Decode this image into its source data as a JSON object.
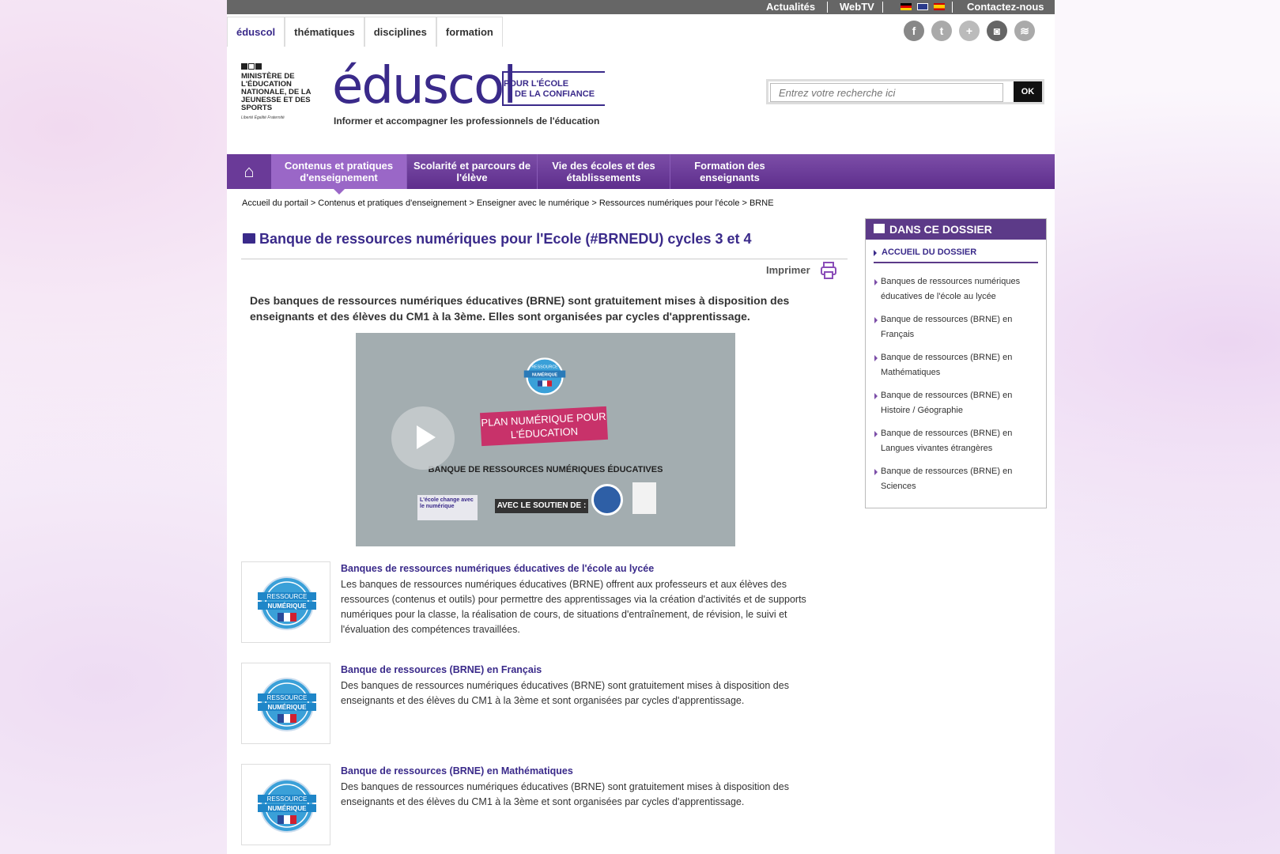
{
  "topbar": {
    "actualites": "Actualités",
    "webtv": "WebTV",
    "contact": "Contactez-nous"
  },
  "tabs": [
    "éduscol",
    "thématiques",
    "disciplines",
    "formation"
  ],
  "social": [
    "f",
    "t",
    "+",
    "◙",
    "≋"
  ],
  "ministry": {
    "text": "MINISTÈRE DE L'ÉDUCATION NATIONALE, DE LA JEUNESSE ET DES SPORTS",
    "motto": "Liberté Égalité Fraternité"
  },
  "logo": {
    "name": "éduscol",
    "tag1": "POUR L'ÉCOLE",
    "tag2": "DE LA CONFIANCE",
    "subtitle": "Informer et accompagner les professionnels de l'éducation"
  },
  "search": {
    "placeholder": "Entrez votre recherche ici",
    "button": "OK"
  },
  "menu": {
    "home_icon": "⌂",
    "items": [
      "Contenus et pratiques d'enseignement",
      "Scolarité et parcours de l'élève",
      "Vie des écoles et des établissements",
      "Formation des enseignants"
    ]
  },
  "breadcrumb": "Accueil du portail > Contenus et pratiques d'enseignement > Enseigner avec le numérique > Ressources numériques pour l'école > BRNE",
  "title": "Banque de ressources numériques pour l'Ecole (#BRNEDU)  cycles 3 et 4",
  "print": "Imprimer",
  "intro": "Des banques de ressources numériques éducatives (BRNE) sont gratuitement mises à disposition des enseignants et des élèves du CM1 à la 3ème. Elles sont organisées par cycles d'apprentissage.",
  "video": {
    "badge1": "RESSOURCE",
    "badge2": "NUMÉRIQUE",
    "plan": "PLAN NUMÉRIQUE POUR L'ÉDUCATION",
    "banque": "BANQUE DE RESSOURCES NUMÉRIQUES ÉDUCATIVES",
    "ecole": "L'école change avec le numérique",
    "soutien": "AVEC LE SOUTIEN DE :"
  },
  "badge": {
    "l1": "RESSOURCE",
    "l2": "NUMÉRIQUE"
  },
  "items": [
    {
      "title": "Banques de ressources numériques éducatives de l'école au lycée",
      "desc": "Les banques de ressources numériques éducatives (BRNE) offrent aux professeurs et aux élèves des ressources (contenus et outils) pour permettre des apprentissages via la création d'activités et de supports numériques pour la classe, la réalisation de cours, de situations d'entraînement, de révision, le suivi et l'évaluation des compétences travaillées."
    },
    {
      "title": "Banque de ressources (BRNE) en Français",
      "desc": "Des banques de ressources numériques éducatives (BRNE) sont gratuitement mises à disposition des enseignants et des élèves du CM1 à la 3ème et sont organisées par cycles d'apprentissage."
    },
    {
      "title": "Banque de ressources (BRNE) en Mathématiques",
      "desc": "Des banques de ressources numériques éducatives (BRNE) sont gratuitement mises à disposition des enseignants et des élèves du CM1 à la 3ème et sont organisées par cycles d'apprentissage."
    }
  ],
  "sidebar": {
    "title": "DANS CE DOSSIER",
    "accueil": "ACCUEIL DU DOSSIER",
    "links": [
      "Banques de ressources numériques éducatives de l'école au lycée",
      "Banque de ressources (BRNE) en Français",
      "Banque de ressources (BRNE) en Mathématiques",
      "Banque de ressources (BRNE) en Histoire / Géographie",
      "Banque de ressources (BRNE) en Langues vivantes étrangères",
      "Banque de ressources (BRNE) en Sciences"
    ]
  }
}
